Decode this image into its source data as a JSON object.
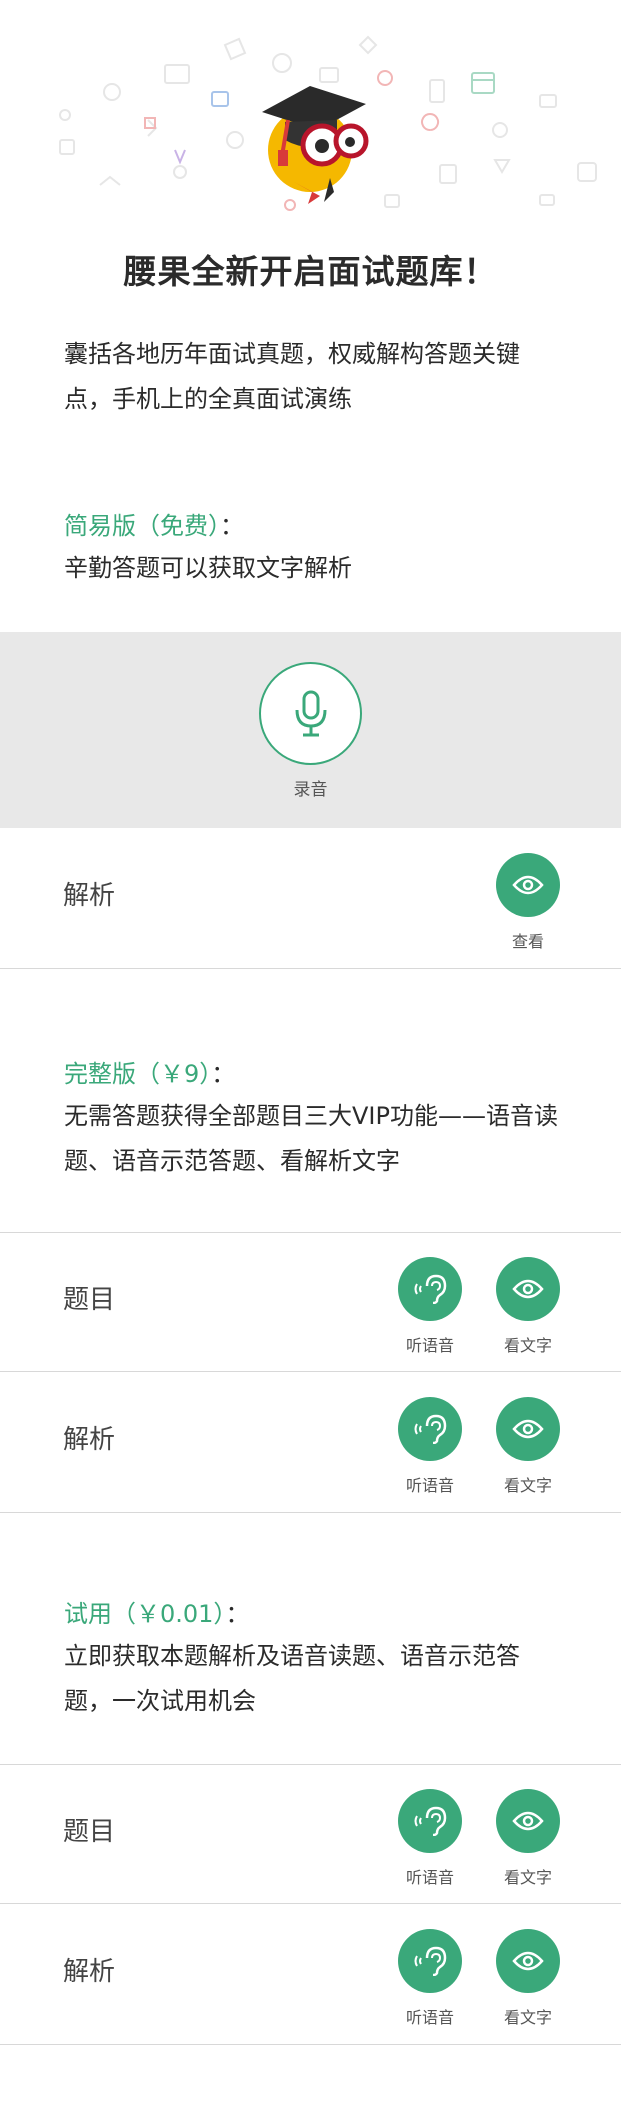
{
  "hero": {
    "title": "腰果全新开启面试题库！"
  },
  "intro": "囊括各地历年面试真题，权威解构答题关键点，手机上的全真面试演练",
  "simple": {
    "title": "简易版（免费）",
    "colon": "：",
    "desc": "辛勤答题可以获取文字解析",
    "record_label": "录音",
    "row_label": "解析",
    "view_label": "查看"
  },
  "full": {
    "title": "完整版（￥9）",
    "colon": "：",
    "desc": "无需答题获得全部题目三大VIP功能——语音读题、语音示范答题、看解析文字",
    "rows": [
      {
        "label": "题目",
        "listen": "听语音",
        "read": "看文字"
      },
      {
        "label": "解析",
        "listen": "听语音",
        "read": "看文字"
      }
    ]
  },
  "trial": {
    "title": "试用（￥0.01）",
    "colon": "：",
    "desc": "立即获取本题解析及语音读题、语音示范答题，一次试用机会",
    "rows": [
      {
        "label": "题目",
        "listen": "听语音",
        "read": "看文字"
      },
      {
        "label": "解析",
        "listen": "听语音",
        "read": "看文字"
      }
    ]
  },
  "colors": {
    "accent": "#3aa87a",
    "band": "#e8e8e8",
    "divider": "#d8d8d8"
  },
  "icons": [
    "mascot-logo",
    "microphone-icon",
    "eye-icon",
    "ear-icon"
  ]
}
